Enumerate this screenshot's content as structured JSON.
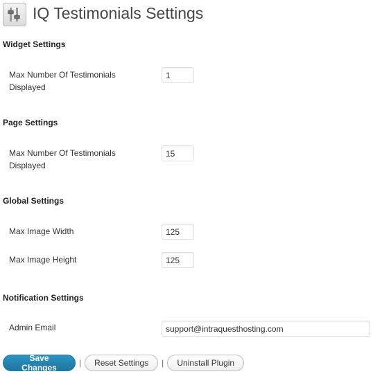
{
  "page": {
    "title": "IQ Testimonials Settings",
    "icon": "settings-sliders-icon"
  },
  "sections": {
    "widget": {
      "heading": "Widget Settings",
      "max_label": "Max Number Of Testimonials Displayed",
      "max_value": "1"
    },
    "page": {
      "heading": "Page Settings",
      "max_label": "Max Number Of Testimonials Displayed",
      "max_value": "15"
    },
    "global": {
      "heading": "Global Settings",
      "width_label": "Max Image Width",
      "width_value": "125",
      "height_label": "Max Image Height",
      "height_value": "125"
    },
    "notification": {
      "heading": "Notification Settings",
      "email_label": "Admin Email",
      "email_value": "support@intraquesthosting.com"
    }
  },
  "buttons": {
    "save": "Save Changes",
    "reset": "Reset Settings",
    "uninstall": "Uninstall Plugin",
    "separator": "|"
  },
  "colors": {
    "primary_button": "#21759b",
    "title_text": "#464646"
  }
}
